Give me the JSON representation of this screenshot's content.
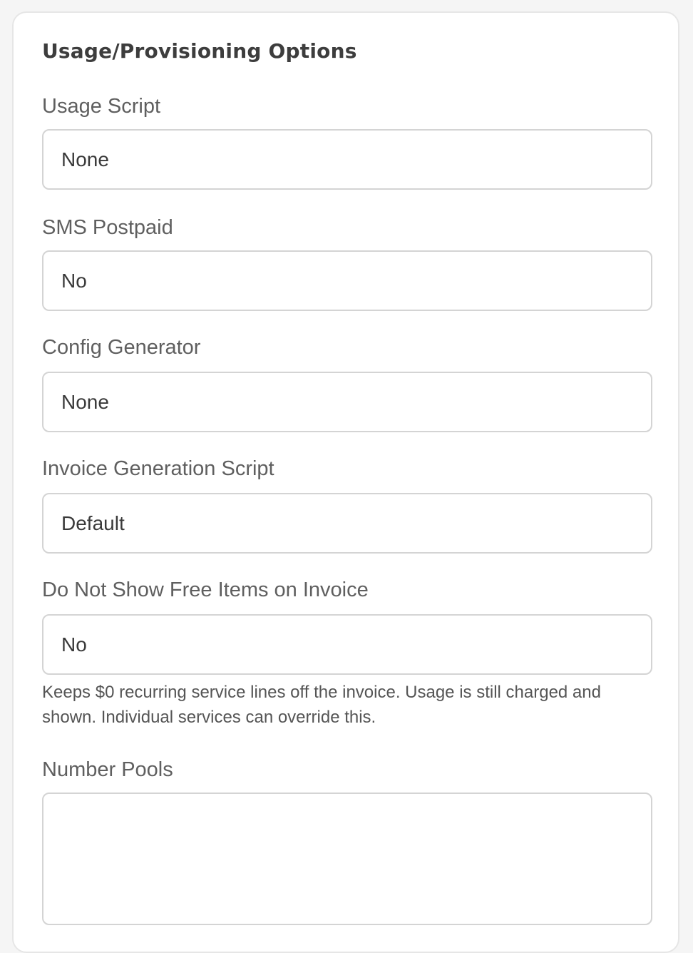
{
  "section": {
    "title": "Usage/Provisioning Options"
  },
  "fields": [
    {
      "label": "Usage Script",
      "value": "None"
    },
    {
      "label": "SMS Postpaid",
      "value": "No"
    },
    {
      "label": "Config Generator",
      "value": "None"
    },
    {
      "label": "Invoice Generation Script",
      "value": "Default"
    },
    {
      "label": "Do Not Show Free Items on Invoice",
      "value": "No",
      "help": "Keeps $0 recurring service lines off the invoice. Usage is still charged and shown. Individual services can override this."
    },
    {
      "label": "Number Pools",
      "value": ""
    }
  ]
}
